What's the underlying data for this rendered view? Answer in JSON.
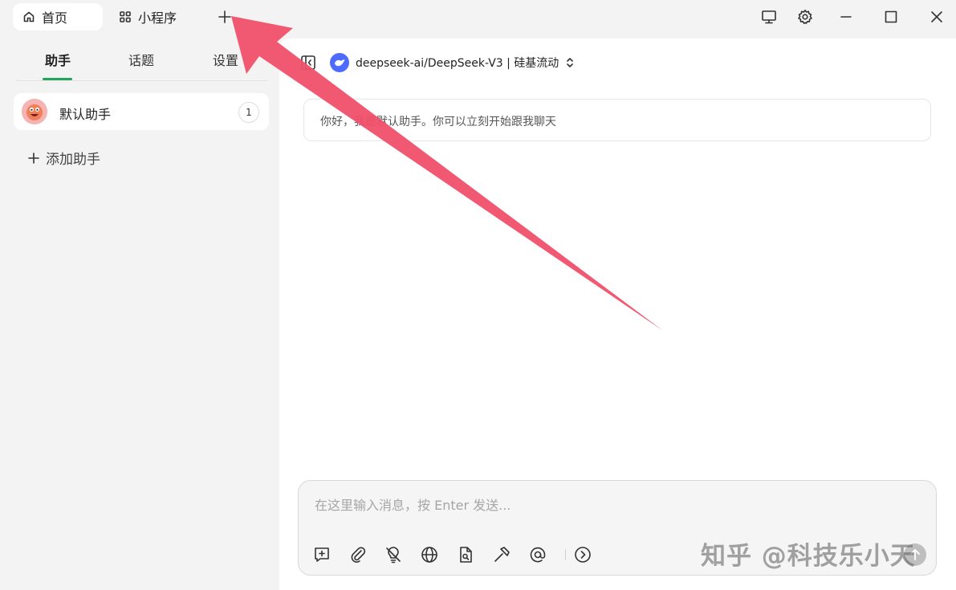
{
  "titlebar": {
    "tabs": [
      {
        "label": "首页",
        "icon": "home-icon"
      },
      {
        "label": "小程序",
        "icon": "grid-icon"
      }
    ],
    "add_tab_icon": "plus-icon",
    "controls": [
      "monitor-icon",
      "gear-icon",
      "minimize-icon",
      "maximize-icon",
      "close-icon"
    ]
  },
  "sidebar": {
    "tabs": [
      {
        "label": "助手",
        "active": true
      },
      {
        "label": "话题",
        "active": false
      },
      {
        "label": "设置",
        "active": false
      }
    ],
    "assistants": [
      {
        "name": "默认助手",
        "count": "1"
      }
    ],
    "add_label": "添加助手"
  },
  "main": {
    "model": {
      "name": "deepseek-ai/DeepSeek-V3 | 硅基流动"
    },
    "greeting": "你好，我是默认助手。你可以立刻开始跟我聊天",
    "input": {
      "placeholder": "在这里输入消息，按 Enter 发送..."
    },
    "toolbar": [
      "new-topic-icon",
      "attachment-icon",
      "lightbulb-icon",
      "globe-icon",
      "knowledge-icon",
      "hammer-icon",
      "mention-icon",
      "expand-icon"
    ]
  },
  "watermark": "知乎 @科技乐小天",
  "colors": {
    "accent": "#22a55b",
    "arrow": "#f0506a",
    "model_logo": "#4d6bfe"
  }
}
